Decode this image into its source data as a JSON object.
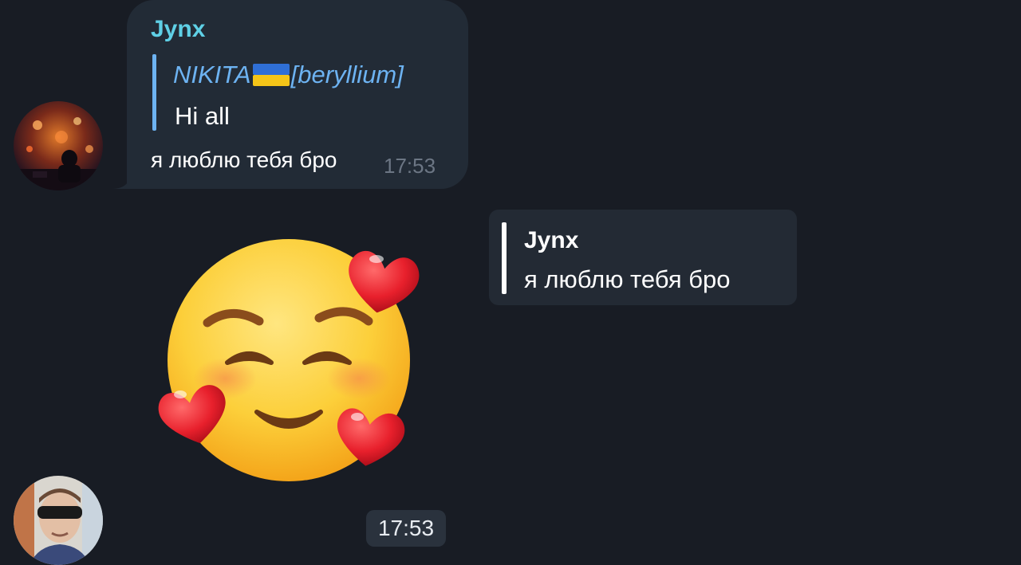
{
  "incoming_message": {
    "sender": "Jynx",
    "reply": {
      "name_prefix": "NIKITA",
      "name_suffix": "[beryllium]",
      "text": "Hi all"
    },
    "text": "я люблю тебя бро",
    "time": "17:53"
  },
  "outgoing_reply": {
    "quoted_name": "Jynx",
    "quoted_text": "я люблю тебя бро"
  },
  "sticker": {
    "name": "smiling-face-with-hearts",
    "time": "17:53"
  },
  "colors": {
    "background": "#181c24",
    "bubble": "#222b36",
    "sender_name": "#5fd0e6",
    "reply_accent": "#6db3f2",
    "timestamp": "#6c7684"
  }
}
